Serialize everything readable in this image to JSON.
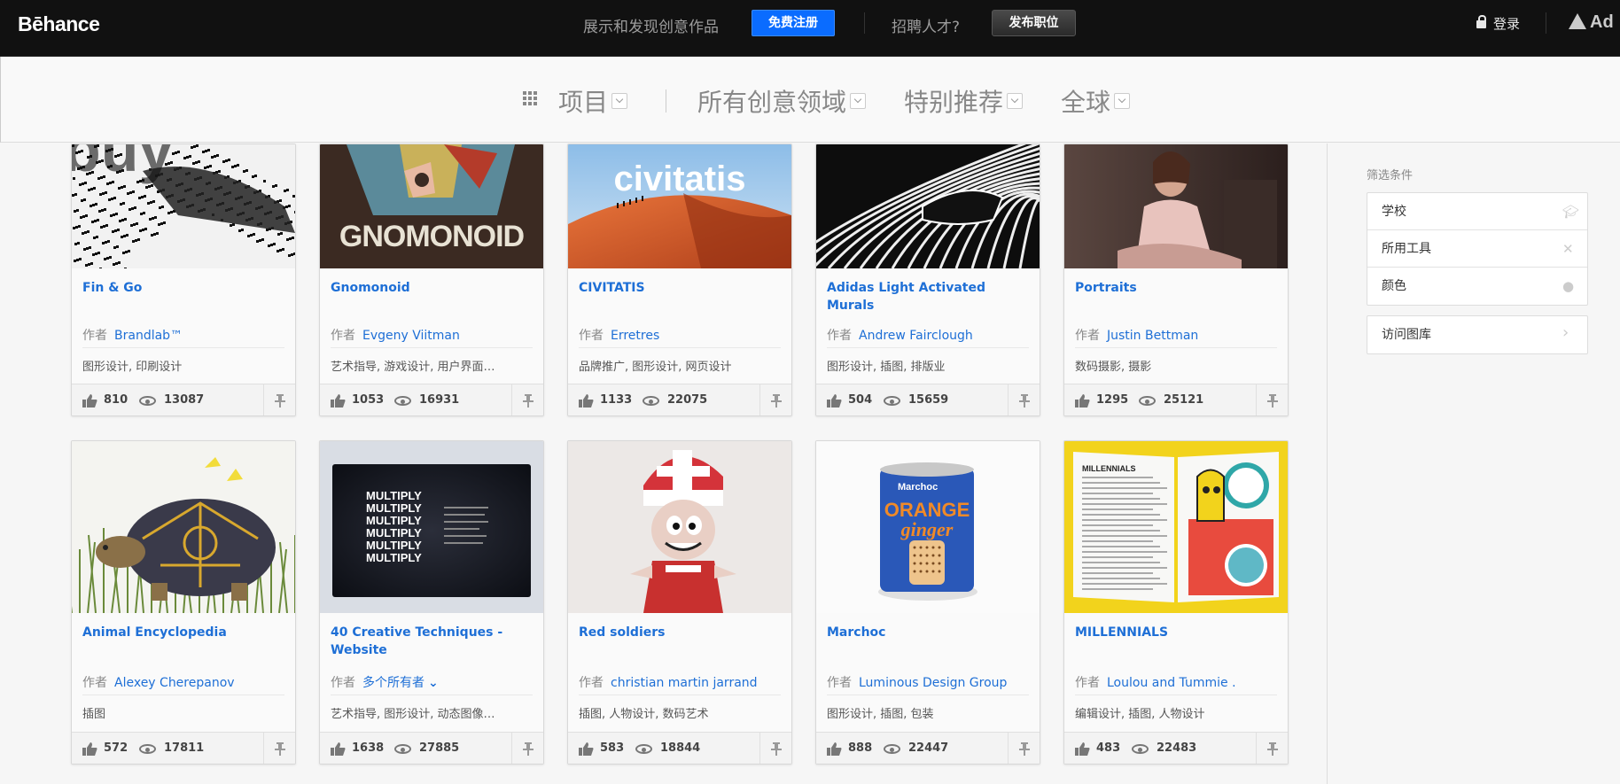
{
  "header": {
    "logo": "Bēhance",
    "tagline": "展示和发现创意作品",
    "signup": "免费注册",
    "hire_prompt": "招聘人才?",
    "post_job": "发布职位",
    "login": "登录",
    "adobe": "Ad"
  },
  "filters": {
    "type": "项目",
    "fields": "所有创意领域",
    "sort": "特别推荐",
    "region": "全球"
  },
  "sidebar": {
    "title": "筛选条件",
    "items": [
      "学校",
      "所用工具",
      "颜色"
    ],
    "gallery": "访问图库"
  },
  "by_label": "作者",
  "projects": [
    {
      "title": "Fin & Go",
      "owner": "Brandlab™",
      "fields": "图形设计, 印刷设计",
      "appreciations": "810",
      "views": "13087"
    },
    {
      "title": "Gnomonoid",
      "owner": "Evgeny Viitman",
      "fields": "艺术指导, 游戏设计, 用户界面…",
      "appreciations": "1053",
      "views": "16931"
    },
    {
      "title": "CIVITATIS",
      "owner": "Erretres",
      "fields": "品牌推广, 图形设计, 网页设计",
      "appreciations": "1133",
      "views": "22075"
    },
    {
      "title": "Adidas Light Activated Murals",
      "owner": "Andrew Fairclough",
      "fields": "图形设计, 插图, 排版业",
      "appreciations": "504",
      "views": "15659"
    },
    {
      "title": "Portraits",
      "owner": "Justin Bettman",
      "fields": "数码摄影, 摄影",
      "appreciations": "1295",
      "views": "25121"
    },
    {
      "title": "Animal Encyclopedia",
      "owner": "Alexey Cherepanov",
      "fields": "插图",
      "appreciations": "572",
      "views": "17811"
    },
    {
      "title": "40 Creative Techniques - Website",
      "owner": "多个所有者",
      "fields": "艺术指导, 图形设计, 动态图像…",
      "appreciations": "1638",
      "views": "27885"
    },
    {
      "title": "Red soldiers",
      "owner": "christian martin jarrand",
      "fields": "插图, 人物设计, 数码艺术",
      "appreciations": "583",
      "views": "18844"
    },
    {
      "title": "Marchoc",
      "owner": "Luminous Design Group",
      "fields": "图形设计, 插图, 包装",
      "appreciations": "888",
      "views": "22447"
    },
    {
      "title": "MILLENNIALS",
      "owner": "Loulou and Tummie .",
      "fields": "编辑设计, 插图, 人物设计",
      "appreciations": "483",
      "views": "22483"
    }
  ],
  "thumb_text": {
    "gnomonoid": "GNOMONOID",
    "civitatis": "civitatis",
    "multiply": "MULTIPLY",
    "marchoc_brand": "Marchoc",
    "marchoc_product": "ORANGE ginger"
  }
}
